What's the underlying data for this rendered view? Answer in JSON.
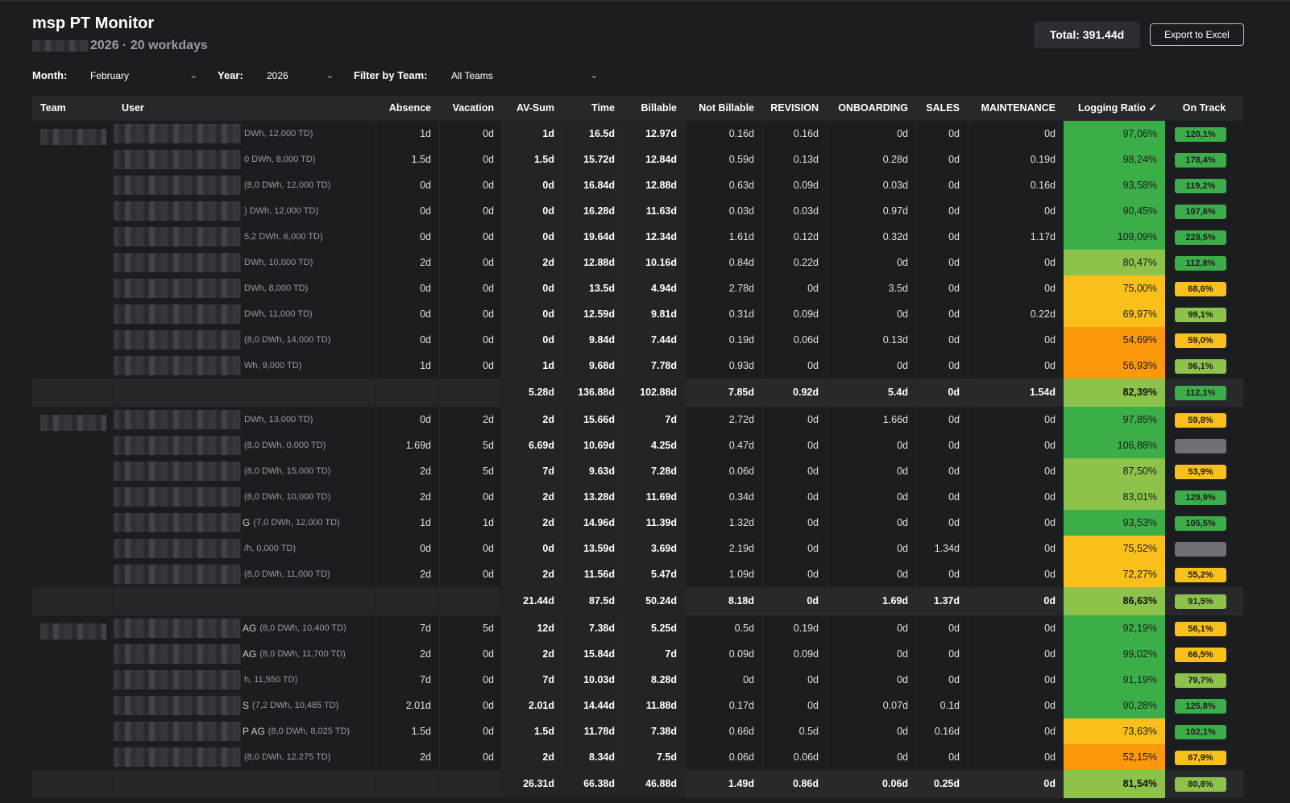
{
  "header": {
    "title": "msp PT Monitor",
    "subtitle": "2026 · 20 workdays",
    "total": "Total: 391.44d",
    "export_label": "Export to Excel"
  },
  "filters": {
    "month_label": "Month:",
    "month_value": "February",
    "year_label": "Year:",
    "year_value": "2026",
    "team_label": "Filter by Team:",
    "team_value": "All Teams"
  },
  "columns": [
    "Team",
    "User",
    "Absence",
    "Vacation",
    "AV-Sum",
    "Time",
    "Billable",
    "Not Billable",
    "REVISION",
    "ONBOARDING",
    "SALES",
    "MAINTENANCE",
    "Logging Ratio ✓",
    "On Track"
  ],
  "colors": {
    "dark_green": "#3cae49",
    "light_green": "#8dc34a",
    "yellow": "#f9c01c",
    "orange": "#fb980c",
    "gray": "#6f7177"
  },
  "rows": [
    {
      "kind": "user",
      "team_blur": true,
      "suffix": "",
      "meta": "DWh, 12,000 TD)",
      "abs": "1d",
      "vac": "0d",
      "av": "1d",
      "time": "16.5d",
      "bill": "12.97d",
      "nb": "0.16d",
      "rev": "0.16d",
      "onb": "0d",
      "sales": "0d",
      "maint": "0d",
      "ratio": "97,06%",
      "ratio_color": "dark_green",
      "ontrack": "120,1%",
      "ontrack_color": "dark_green"
    },
    {
      "kind": "user",
      "suffix": "",
      "meta": "0 DWh, 8,000 TD)",
      "abs": "1.5d",
      "vac": "0d",
      "av": "1.5d",
      "time": "15.72d",
      "bill": "12.84d",
      "nb": "0.59d",
      "rev": "0.13d",
      "onb": "0.28d",
      "sales": "0d",
      "maint": "0.19d",
      "ratio": "98,24%",
      "ratio_color": "dark_green",
      "ontrack": "178,4%",
      "ontrack_color": "dark_green"
    },
    {
      "kind": "user",
      "suffix": "",
      "meta": "(8,0 DWh, 12,000 TD)",
      "abs": "0d",
      "vac": "0d",
      "av": "0d",
      "time": "16.84d",
      "bill": "12.88d",
      "nb": "0.63d",
      "rev": "0.09d",
      "onb": "0.03d",
      "sales": "0d",
      "maint": "0.16d",
      "ratio": "93,58%",
      "ratio_color": "dark_green",
      "ontrack": "119,2%",
      "ontrack_color": "dark_green"
    },
    {
      "kind": "user",
      "suffix": "",
      "meta": ") DWh, 12,000 TD)",
      "abs": "0d",
      "vac": "0d",
      "av": "0d",
      "time": "16.28d",
      "bill": "11.63d",
      "nb": "0.03d",
      "rev": "0.03d",
      "onb": "0.97d",
      "sales": "0d",
      "maint": "0d",
      "ratio": "90,45%",
      "ratio_color": "dark_green",
      "ontrack": "107,6%",
      "ontrack_color": "dark_green"
    },
    {
      "kind": "user",
      "suffix": "",
      "meta": "5,2 DWh, 6,000 TD)",
      "abs": "0d",
      "vac": "0d",
      "av": "0d",
      "time": "19.64d",
      "bill": "12.34d",
      "nb": "1.61d",
      "rev": "0.12d",
      "onb": "0.32d",
      "sales": "0d",
      "maint": "1.17d",
      "ratio": "109,09%",
      "ratio_color": "dark_green",
      "ontrack": "228,5%",
      "ontrack_color": "dark_green"
    },
    {
      "kind": "user",
      "suffix": "",
      "meta": "DWh, 10,000 TD)",
      "abs": "2d",
      "vac": "0d",
      "av": "2d",
      "time": "12.88d",
      "bill": "10.16d",
      "nb": "0.84d",
      "rev": "0.22d",
      "onb": "0d",
      "sales": "0d",
      "maint": "0d",
      "ratio": "80,47%",
      "ratio_color": "light_green",
      "ontrack": "112,8%",
      "ontrack_color": "dark_green"
    },
    {
      "kind": "user",
      "suffix": "",
      "meta": "DWh, 8,000 TD)",
      "abs": "0d",
      "vac": "0d",
      "av": "0d",
      "time": "13.5d",
      "bill": "4.94d",
      "nb": "2.78d",
      "rev": "0d",
      "onb": "3.5d",
      "sales": "0d",
      "maint": "0d",
      "ratio": "75,00%",
      "ratio_color": "yellow",
      "ontrack": "68,6%",
      "ontrack_color": "yellow"
    },
    {
      "kind": "user",
      "suffix": "",
      "meta": "DWh, 11,000 TD)",
      "abs": "0d",
      "vac": "0d",
      "av": "0d",
      "time": "12.59d",
      "bill": "9.81d",
      "nb": "0.31d",
      "rev": "0.09d",
      "onb": "0d",
      "sales": "0d",
      "maint": "0.22d",
      "ratio": "69,97%",
      "ratio_color": "yellow",
      "ontrack": "99,1%",
      "ontrack_color": "light_green"
    },
    {
      "kind": "user",
      "suffix": "",
      "meta": "(8,0 DWh, 14,000 TD)",
      "abs": "0d",
      "vac": "0d",
      "av": "0d",
      "time": "9.84d",
      "bill": "7.44d",
      "nb": "0.19d",
      "rev": "0.06d",
      "onb": "0.13d",
      "sales": "0d",
      "maint": "0d",
      "ratio": "54,69%",
      "ratio_color": "orange",
      "ontrack": "59,0%",
      "ontrack_color": "yellow"
    },
    {
      "kind": "user",
      "suffix": "",
      "meta": "Wh, 9,000 TD)",
      "abs": "1d",
      "vac": "0d",
      "av": "1d",
      "time": "9.68d",
      "bill": "7.78d",
      "nb": "0.93d",
      "rev": "0d",
      "onb": "0d",
      "sales": "0d",
      "maint": "0d",
      "ratio": "56,93%",
      "ratio_color": "orange",
      "ontrack": "96,1%",
      "ontrack_color": "light_green"
    },
    {
      "kind": "sum",
      "av": "5.28d",
      "time": "136.88d",
      "bill": "102.88d",
      "nb": "7.85d",
      "rev": "0.92d",
      "onb": "5.4d",
      "sales": "0d",
      "maint": "1.54d",
      "ratio": "82,39%",
      "ratio_color": "light_green",
      "ontrack": "112,1%",
      "ontrack_color": "dark_green"
    },
    {
      "kind": "user",
      "team_blur": true,
      "suffix": "",
      "meta": "DWh, 13,000 TD)",
      "abs": "0d",
      "vac": "2d",
      "av": "2d",
      "time": "15.66d",
      "bill": "7d",
      "nb": "2.72d",
      "rev": "0d",
      "onb": "1.66d",
      "sales": "0d",
      "maint": "0d",
      "ratio": "97,85%",
      "ratio_color": "dark_green",
      "ontrack": "59,8%",
      "ontrack_color": "yellow"
    },
    {
      "kind": "user",
      "suffix": "",
      "meta": "(8,0 DWh, 0,000 TD)",
      "abs": "1.69d",
      "vac": "5d",
      "av": "6.69d",
      "time": "10.69d",
      "bill": "4.25d",
      "nb": "0.47d",
      "rev": "0d",
      "onb": "0d",
      "sales": "0d",
      "maint": "0d",
      "ratio": "106,88%",
      "ratio_color": "dark_green",
      "ontrack": "",
      "ontrack_color": "gray"
    },
    {
      "kind": "user",
      "suffix": "",
      "meta": "(8,0 DWh, 15,000 TD)",
      "abs": "2d",
      "vac": "5d",
      "av": "7d",
      "time": "9.63d",
      "bill": "7.28d",
      "nb": "0.06d",
      "rev": "0d",
      "onb": "0d",
      "sales": "0d",
      "maint": "0d",
      "ratio": "87,50%",
      "ratio_color": "light_green",
      "ontrack": "53,9%",
      "ontrack_color": "yellow"
    },
    {
      "kind": "user",
      "suffix": "",
      "meta": "(8,0 DWh, 10,000 TD)",
      "abs": "2d",
      "vac": "0d",
      "av": "2d",
      "time": "13.28d",
      "bill": "11.69d",
      "nb": "0.34d",
      "rev": "0d",
      "onb": "0d",
      "sales": "0d",
      "maint": "0d",
      "ratio": "83,01%",
      "ratio_color": "light_green",
      "ontrack": "129,9%",
      "ontrack_color": "dark_green"
    },
    {
      "kind": "user",
      "suffix": "G",
      "meta": "(7,0 DWh, 12,000 TD)",
      "abs": "1d",
      "vac": "1d",
      "av": "2d",
      "time": "14.96d",
      "bill": "11.39d",
      "nb": "1.32d",
      "rev": "0d",
      "onb": "0d",
      "sales": "0d",
      "maint": "0d",
      "ratio": "93,53%",
      "ratio_color": "dark_green",
      "ontrack": "105,5%",
      "ontrack_color": "dark_green"
    },
    {
      "kind": "user",
      "suffix": "",
      "meta": "/h, 0,000 TD)",
      "abs": "0d",
      "vac": "0d",
      "av": "0d",
      "time": "13.59d",
      "bill": "3.69d",
      "nb": "2.19d",
      "rev": "0d",
      "onb": "0d",
      "sales": "1.34d",
      "maint": "0d",
      "ratio": "75,52%",
      "ratio_color": "yellow",
      "ontrack": "",
      "ontrack_color": "gray"
    },
    {
      "kind": "user",
      "suffix": "",
      "meta": "(8,0 DWh, 11,000 TD)",
      "abs": "2d",
      "vac": "0d",
      "av": "2d",
      "time": "11.56d",
      "bill": "5.47d",
      "nb": "1.09d",
      "rev": "0d",
      "onb": "0d",
      "sales": "0d",
      "maint": "0d",
      "ratio": "72,27%",
      "ratio_color": "yellow",
      "ontrack": "55,2%",
      "ontrack_color": "yellow"
    },
    {
      "kind": "sum",
      "av": "21.44d",
      "time": "87.5d",
      "bill": "50.24d",
      "nb": "8.18d",
      "rev": "0d",
      "onb": "1.69d",
      "sales": "1.37d",
      "maint": "0d",
      "ratio": "86,63%",
      "ratio_color": "light_green",
      "ontrack": "91,5%",
      "ontrack_color": "light_green"
    },
    {
      "kind": "user",
      "team_blur": true,
      "suffix": "AG",
      "meta": "(8,0 DWh, 10,400 TD)",
      "abs": "7d",
      "vac": "5d",
      "av": "12d",
      "time": "7.38d",
      "bill": "5.25d",
      "nb": "0.5d",
      "rev": "0.19d",
      "onb": "0d",
      "sales": "0d",
      "maint": "0d",
      "ratio": "92,19%",
      "ratio_color": "dark_green",
      "ontrack": "56,1%",
      "ontrack_color": "yellow"
    },
    {
      "kind": "user",
      "suffix": "AG",
      "meta": "(8,0 DWh, 11,700 TD)",
      "abs": "2d",
      "vac": "0d",
      "av": "2d",
      "time": "15.84d",
      "bill": "7d",
      "nb": "0.09d",
      "rev": "0.09d",
      "onb": "0d",
      "sales": "0d",
      "maint": "0d",
      "ratio": "99,02%",
      "ratio_color": "dark_green",
      "ontrack": "66,5%",
      "ontrack_color": "yellow"
    },
    {
      "kind": "user",
      "suffix": "",
      "meta": "h, 11,550 TD)",
      "abs": "7d",
      "vac": "0d",
      "av": "7d",
      "time": "10.03d",
      "bill": "8.28d",
      "nb": "0d",
      "rev": "0d",
      "onb": "0d",
      "sales": "0d",
      "maint": "0d",
      "ratio": "91,19%",
      "ratio_color": "dark_green",
      "ontrack": "79,7%",
      "ontrack_color": "light_green"
    },
    {
      "kind": "user",
      "suffix": "S",
      "meta": "(7,2 DWh, 10,485 TD)",
      "abs": "2.01d",
      "vac": "0d",
      "av": "2.01d",
      "time": "14.44d",
      "bill": "11.88d",
      "nb": "0.17d",
      "rev": "0d",
      "onb": "0.07d",
      "sales": "0.1d",
      "maint": "0d",
      "ratio": "90,28%",
      "ratio_color": "dark_green",
      "ontrack": "125,8%",
      "ontrack_color": "dark_green"
    },
    {
      "kind": "user",
      "suffix": "P AG",
      "meta": "(8,0 DWh, 8,025 TD)",
      "abs": "1.5d",
      "vac": "0d",
      "av": "1.5d",
      "time": "11.78d",
      "bill": "7.38d",
      "nb": "0.66d",
      "rev": "0.5d",
      "onb": "0d",
      "sales": "0.16d",
      "maint": "0d",
      "ratio": "73,63%",
      "ratio_color": "yellow",
      "ontrack": "102,1%",
      "ontrack_color": "dark_green"
    },
    {
      "kind": "user",
      "suffix": "",
      "meta": "(8,0 DWh, 12,275 TD)",
      "abs": "2d",
      "vac": "0d",
      "av": "2d",
      "time": "8.34d",
      "bill": "7.5d",
      "nb": "0.06d",
      "rev": "0.06d",
      "onb": "0d",
      "sales": "0d",
      "maint": "0d",
      "ratio": "52,15%",
      "ratio_color": "orange",
      "ontrack": "67,9%",
      "ontrack_color": "yellow"
    },
    {
      "kind": "sum",
      "av": "26.31d",
      "time": "66.38d",
      "bill": "46.88d",
      "nb": "1.49d",
      "rev": "0.86d",
      "onb": "0.06d",
      "sales": "0.25d",
      "maint": "0d",
      "ratio": "81,54%",
      "ratio_color": "light_green",
      "ontrack": "80,8%",
      "ontrack_color": "light_green"
    }
  ]
}
